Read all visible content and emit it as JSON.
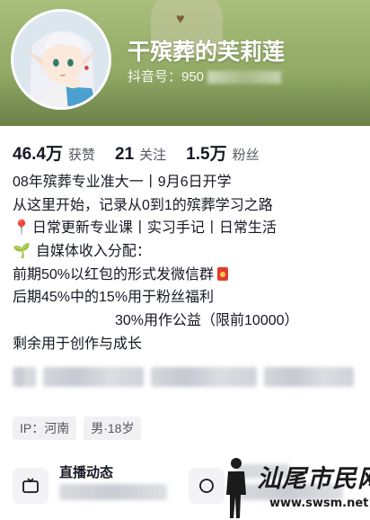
{
  "profile": {
    "nickname": "干殡葬的芙莉莲",
    "douyin_id_label": "抖音号：950"
  },
  "stats": [
    {
      "value": "46.4万",
      "label": "获赞"
    },
    {
      "value": "21",
      "label": "关注"
    },
    {
      "value": "1.5万",
      "label": "粉丝"
    }
  ],
  "bio": {
    "line1": "08年殡葬专业准大一丨9月6日开学",
    "line2": "从这里开始，记录从0到1的殡葬学习之路",
    "line3": "日常更新专业课丨实习手记丨日常生活",
    "line4": "自媒体收入分配：",
    "line5": "前期50%以红包的形式发微信群",
    "line6": "后期45%中的15%用于粉丝福利",
    "line7": "30%用作公益（限前10000）",
    "line8": "剩余用于创作与成长",
    "pin_icon": "📍",
    "sprout_icon": "🌱"
  },
  "tags": [
    "IP：河南",
    "男·18岁"
  ],
  "entries": {
    "live_title": "直播动态"
  },
  "watermark": {
    "text": "汕尾市民网",
    "url": "www.swsm.net"
  },
  "colors": {
    "banner": "#95ad68",
    "text": "#161823",
    "muted": "#555761",
    "tag_bg": "#f1f1f3"
  }
}
